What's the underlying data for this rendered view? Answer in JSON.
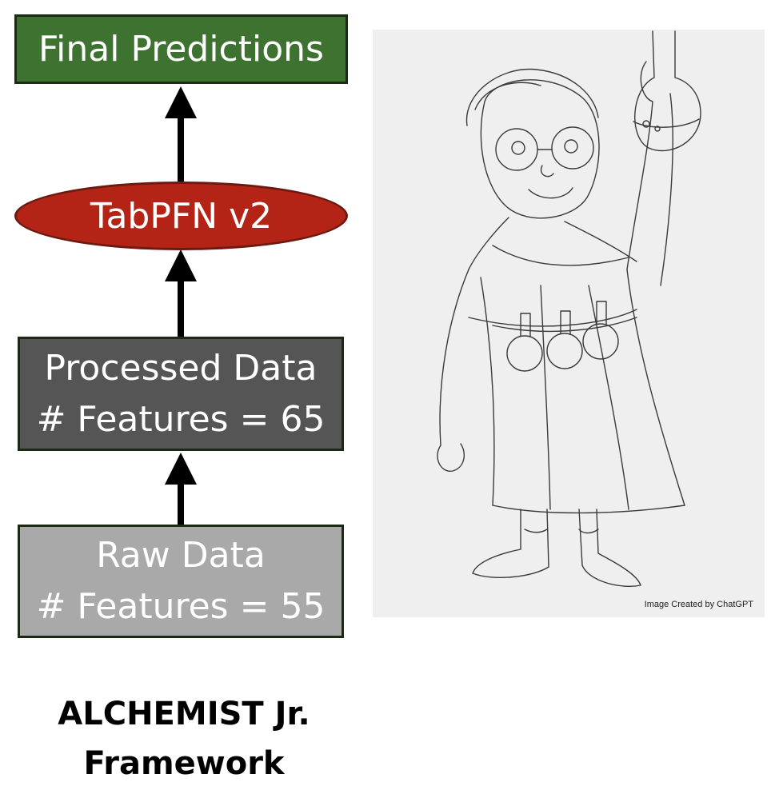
{
  "diagram": {
    "final_box": {
      "label": "Final Predictions"
    },
    "model_node": {
      "label": "TabPFN v2"
    },
    "processed_box": {
      "title": "Processed Data",
      "features": "# Features = 65"
    },
    "raw_box": {
      "title": "Raw Data",
      "features": "# Features = 55"
    },
    "caption": {
      "line1": "ALCHEMIST Jr.",
      "line2": "Framework"
    }
  },
  "illustration": {
    "credit": "Image Created by ChatGPT",
    "subject": "pencil-sketch-young-alchemist"
  },
  "colors": {
    "final_fill": "#3d7230",
    "model_fill": "#b32416",
    "processed_fill": "#555555",
    "raw_fill": "#a9a9a9",
    "arrow": "#000000"
  }
}
